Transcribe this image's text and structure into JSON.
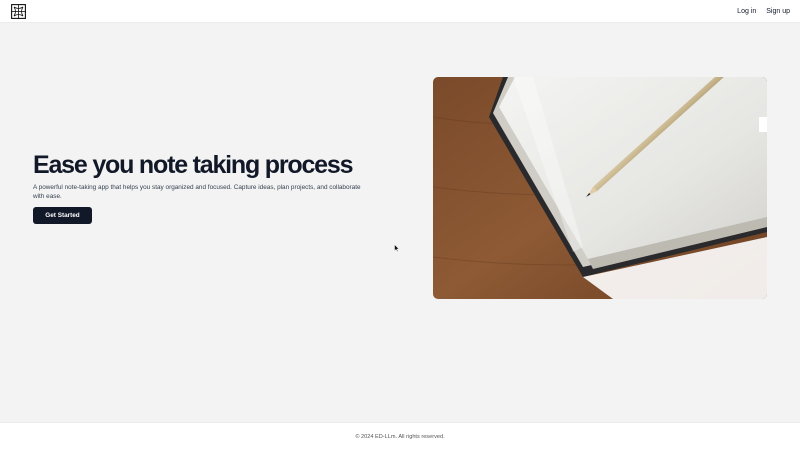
{
  "header": {
    "logo_icon": "notebook-logo-icon",
    "login_label": "Log in",
    "signup_label": "Sign up"
  },
  "hero": {
    "title": "Ease you note taking process",
    "description": "A powerful note-taking app that helps you stay organized and focused. Capture ideas, plan projects, and collaborate with ease.",
    "cta_label": "Get Started",
    "image_subject": "open notebook with pencil on wooden desk"
  },
  "footer": {
    "copyright": "© 2024 ED-LLm. All rights reserved."
  },
  "colors": {
    "primary": "#111827",
    "background": "#f3f3f3"
  }
}
